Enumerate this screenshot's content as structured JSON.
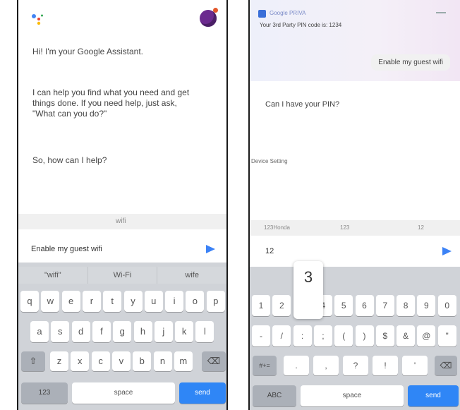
{
  "left_phone": {
    "greeting": "Hi! I'm your Google Assistant.",
    "help_text": "I can help you find what you need and get things done. If you need help, just ask, \"What can you do?\"",
    "prompt": "So, how can I help?",
    "chip": "wifi",
    "input_value": "Enable my guest wifi",
    "suggestions": [
      "\"wifi\"",
      "Wi-Fi",
      "wife"
    ],
    "keys_row1": [
      "q",
      "w",
      "e",
      "r",
      "t",
      "y",
      "u",
      "i",
      "o",
      "p"
    ],
    "keys_row2": [
      "a",
      "s",
      "d",
      "f",
      "g",
      "h",
      "j",
      "k",
      "l"
    ],
    "keys_row3": [
      "z",
      "x",
      "c",
      "v",
      "b",
      "n",
      "m"
    ],
    "shift_glyph": "⇧",
    "delete_glyph": "⌫",
    "num_key": "123",
    "space_key": "space",
    "send_key": "send"
  },
  "right_phone": {
    "notification_title": "Google PRIVA",
    "notification_body": "Your 3rd Party PIN code is: 1234",
    "user_message": "Enable my guest wifi",
    "assistant_message": "Can I have your PIN?",
    "side_label": "Device Setting",
    "chips": [
      "123Honda",
      "123",
      "12"
    ],
    "input_value": "12",
    "popup_key": "3",
    "row1": [
      "1",
      "2",
      "3",
      "4",
      "5",
      "6",
      "7",
      "8",
      "9",
      "0"
    ],
    "row2": [
      "-",
      "/",
      ":",
      ";",
      "(",
      ")",
      "$",
      "&",
      "@",
      "\""
    ],
    "row3": [
      ".",
      ",",
      "?",
      "!",
      "'"
    ],
    "symbols_key": "#+=",
    "delete_glyph": "⌫",
    "abc_key": "ABC",
    "space_key": "space",
    "send_key": "send"
  },
  "colors": {
    "send_arrow": "#3b82f6",
    "send_key": "#2f86f6",
    "keyboard_bg": "#d0d3d8",
    "avatar": "#6b2a8f"
  }
}
